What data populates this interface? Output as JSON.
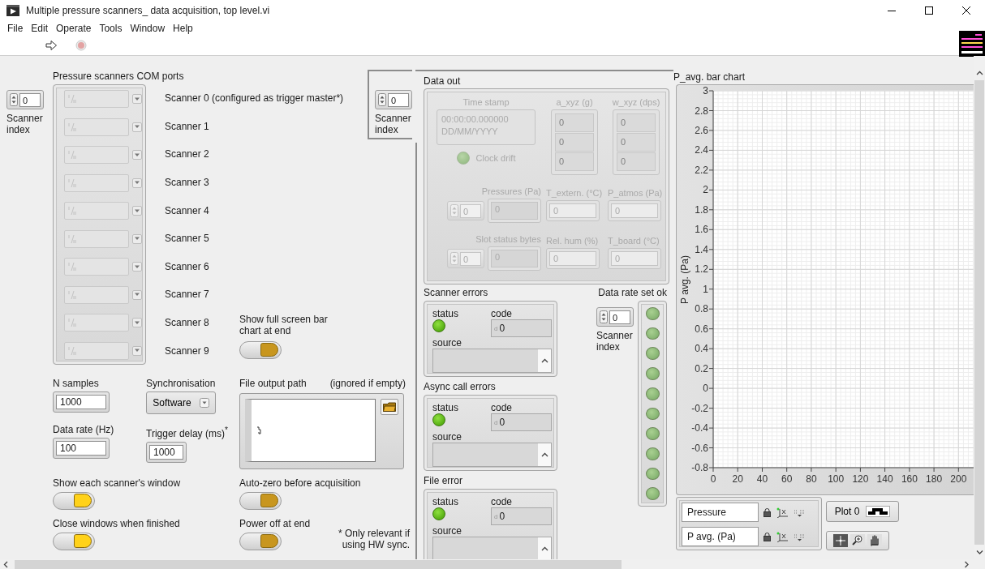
{
  "window": {
    "title": "Multiple pressure scanners_ data acquisition, top level.vi"
  },
  "menu": [
    "File",
    "Edit",
    "Operate",
    "Tools",
    "Window",
    "Help"
  ],
  "com_ports": {
    "label": "Pressure scanners COM ports",
    "index": {
      "value": "0",
      "label": "Scanner index"
    },
    "scanners": [
      {
        "label": "Scanner 0 (configured as trigger master*)",
        "disabled": true
      },
      {
        "label": "Scanner 1",
        "disabled": true
      },
      {
        "label": "Scanner 2",
        "disabled": true
      },
      {
        "label": "Scanner 3",
        "disabled": true
      },
      {
        "label": "Scanner 4",
        "disabled": true
      },
      {
        "label": "Scanner 5",
        "disabled": true
      },
      {
        "label": "Scanner 6",
        "disabled": true
      },
      {
        "label": "Scanner 7",
        "disabled": true
      },
      {
        "label": "Scanner 8",
        "disabled": true
      },
      {
        "label": "Scanner 9",
        "disabled": true
      }
    ]
  },
  "full_screen_chart": {
    "label": "Show full screen bar chart at end",
    "on": true,
    "color": "#c8961e"
  },
  "settings": {
    "n_samples": {
      "label": "N samples",
      "value": "1000"
    },
    "synchronisation": {
      "label": "Synchronisation",
      "value": "Software"
    },
    "data_rate": {
      "label": "Data rate (Hz)",
      "value": "100"
    },
    "trigger_delay": {
      "label": "Trigger delay (ms)$^{*}$",
      "value": "1000"
    },
    "file_output_path": {
      "label": "File output path",
      "note": "(ignored if empty)"
    }
  },
  "switches": [
    {
      "label": "Show each scanner's window",
      "on": true,
      "color": "#ffd21a"
    },
    {
      "label": "Auto-zero before acquisition",
      "on": true,
      "color": "#c8961e"
    },
    {
      "label": "Close windows when finished",
      "on": true,
      "color": "#ffd21a"
    },
    {
      "label": "Power off at end",
      "on": true,
      "color": "#c8961e"
    }
  ],
  "footnote": "* Only relevant if using HW sync.",
  "data_out": {
    "label": "Data out",
    "disabled": true,
    "index": {
      "value": "0",
      "label": "Scanner index"
    },
    "time_stamp": {
      "label": "Time stamp",
      "value": "00:00:00.000000\nDD/MM/YYYY"
    },
    "clock_drift": {
      "label": "Clock drift",
      "on": false
    },
    "a_xyz": {
      "label": "a_xyz (g)",
      "values": [
        "0",
        "0",
        "0"
      ]
    },
    "w_xyz": {
      "label": "w_xyz (dps)",
      "values": [
        "0",
        "0",
        "0"
      ]
    },
    "pressures": {
      "label": "Pressures (Pa)",
      "index": "0",
      "value": "0"
    },
    "t_extern": {
      "label": "T_extern. (°C)",
      "value": "0"
    },
    "p_atmos": {
      "label": "P_atmos (Pa)",
      "value": "0"
    },
    "slot_status": {
      "label": "Slot status bytes",
      "index": "0",
      "value": "0"
    },
    "rel_hum": {
      "label": "Rel. hum (%)",
      "value": "0"
    },
    "t_board": {
      "label": "T_board (°C)",
      "value": "0"
    }
  },
  "errors": [
    {
      "label": "Scanner errors",
      "status_label": "status",
      "status": false,
      "code_label": "code",
      "radix": "d",
      "code": "0",
      "source_label": "source"
    },
    {
      "label": "Async call errors",
      "status_label": "status",
      "status": false,
      "code_label": "code",
      "radix": "d",
      "code": "0",
      "source_label": "source"
    },
    {
      "label": "File error",
      "status_label": "status",
      "status": false,
      "code_label": "code",
      "radix": "d",
      "code": "0",
      "source_label": "source"
    }
  ],
  "data_rate_ok": {
    "label": "Data rate set ok",
    "index": {
      "value": "0",
      "label": "Scanner index"
    },
    "leds": [
      {
        "on": false
      },
      {
        "on": false
      },
      {
        "on": false
      },
      {
        "on": false
      },
      {
        "on": false
      },
      {
        "on": false
      },
      {
        "on": false
      },
      {
        "on": false
      },
      {
        "on": false
      },
      {
        "on": false
      }
    ]
  },
  "chart": {
    "chart_data": {
      "type": "bar",
      "title": "P_avg. bar chart",
      "grid": true,
      "ylabel": "P avg. (Pa)",
      "xlim": [
        0,
        213
      ],
      "ylim": [
        -0.8,
        3
      ],
      "xticks": [
        0,
        20,
        40,
        60,
        80,
        100,
        120,
        140,
        160,
        180,
        200
      ],
      "yticks": [
        3,
        2.8,
        2.6,
        2.4,
        2.2,
        2,
        1.8,
        1.6,
        1.4,
        1.2,
        1,
        0.8,
        0.6,
        0.4,
        0.2,
        0,
        -0.2,
        -0.4,
        -0.6,
        -0.8
      ]
    },
    "scale_legend": [
      {
        "name": "Pressure"
      },
      {
        "name": "P avg. (Pa)"
      }
    ],
    "plot_legend": {
      "name": "Plot 0"
    }
  }
}
